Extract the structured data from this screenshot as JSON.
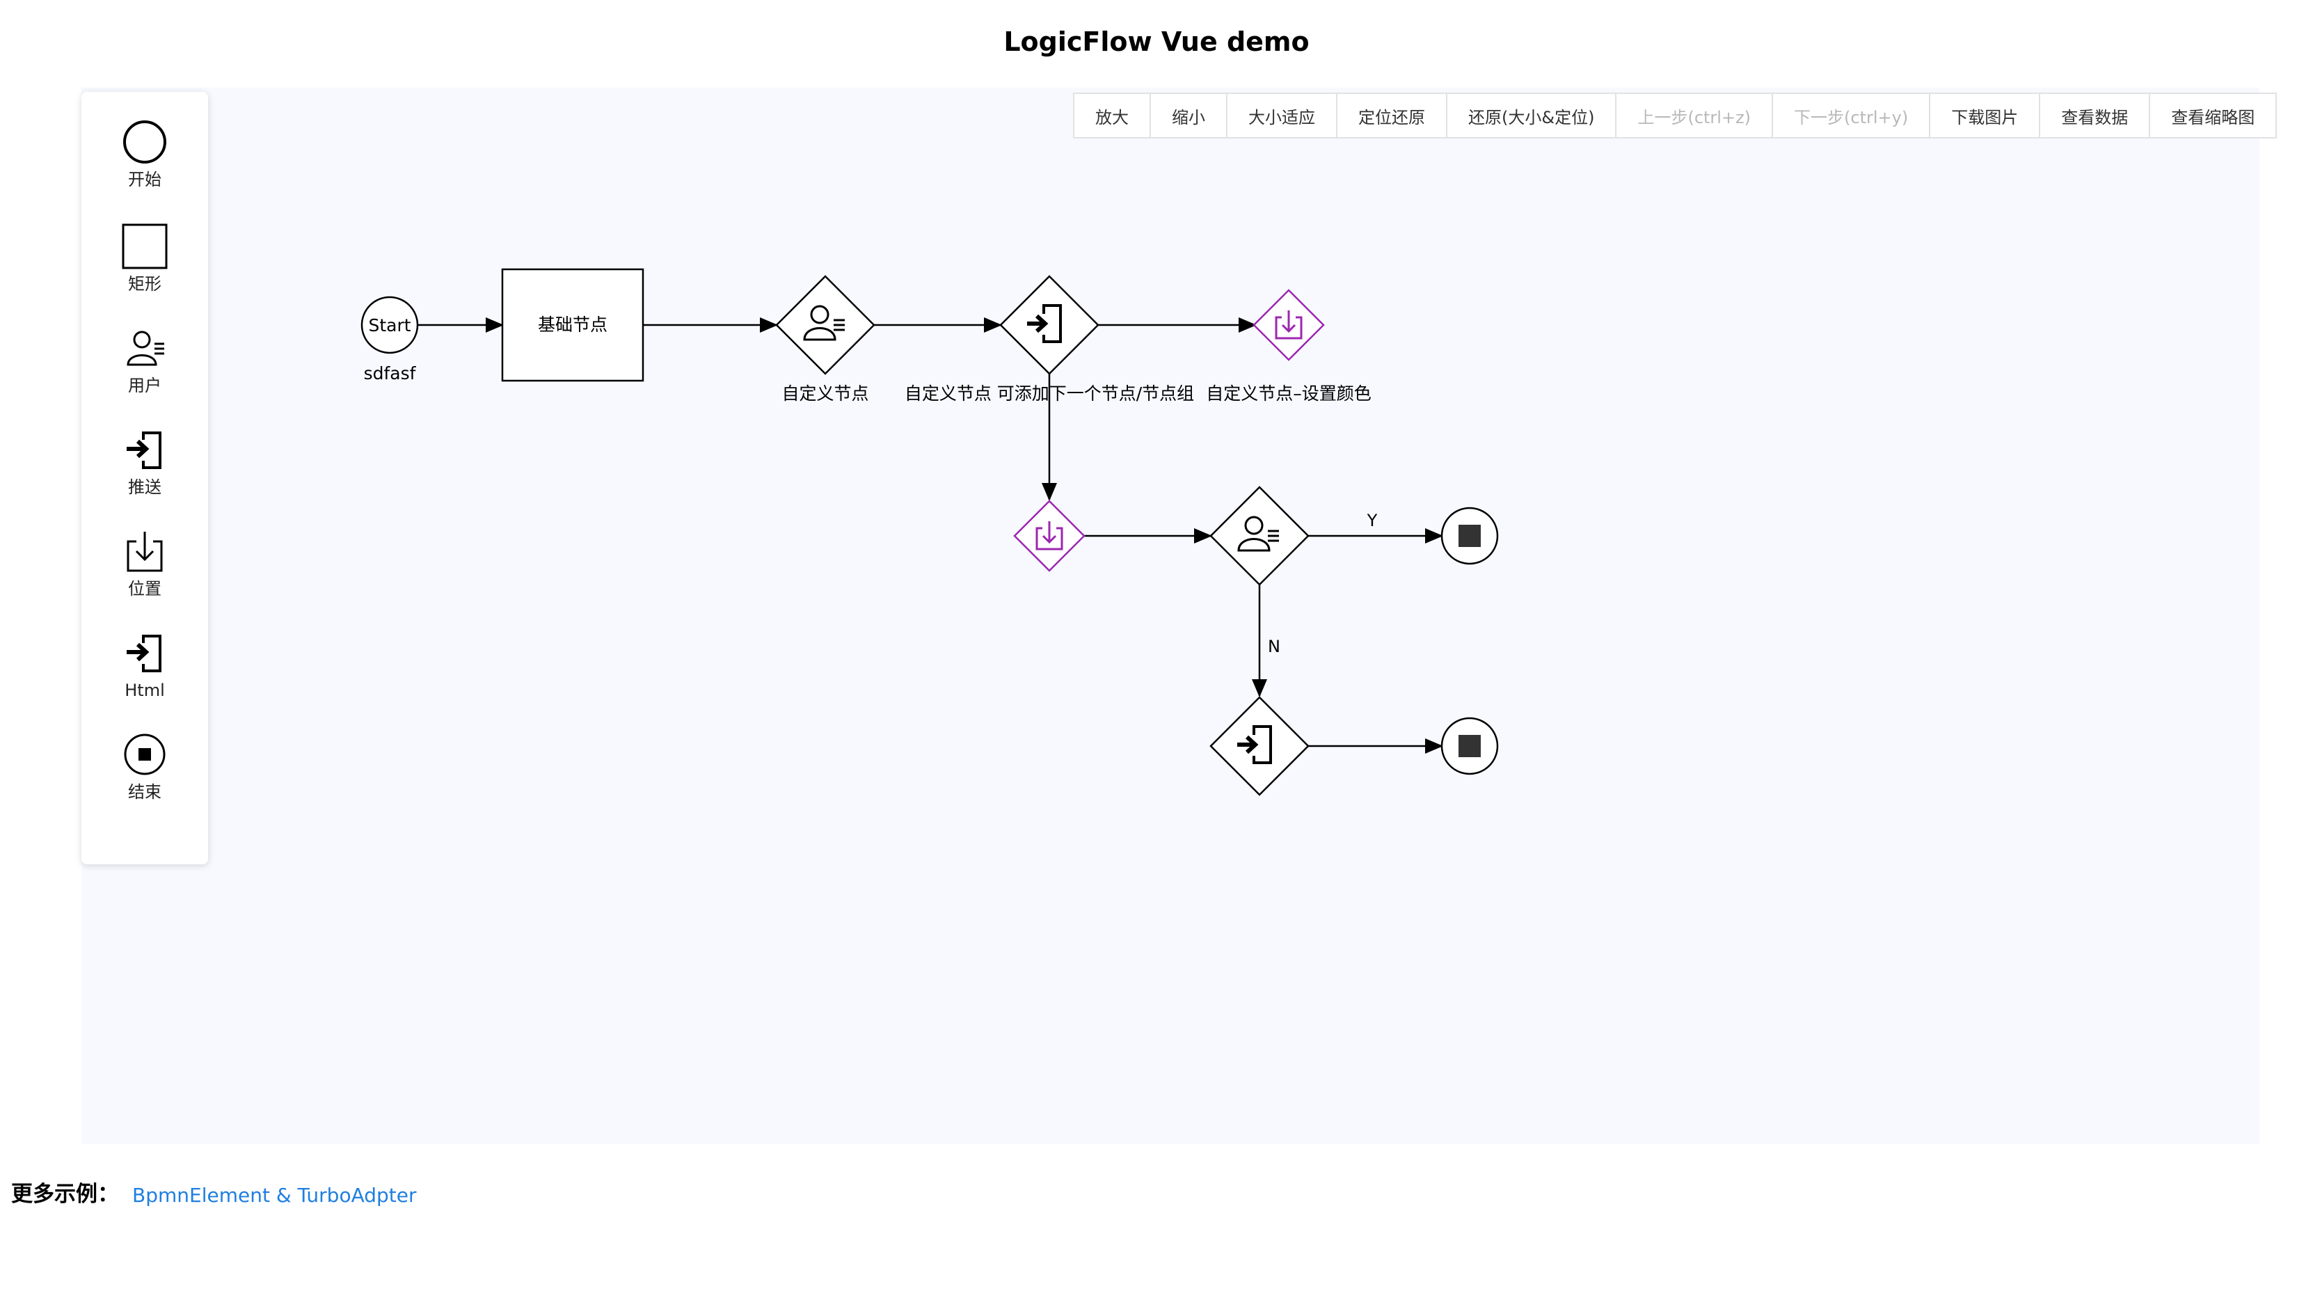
{
  "page": {
    "title": "LogicFlow Vue demo"
  },
  "palette": {
    "items": [
      {
        "label": "开始",
        "icon": "circle-icon"
      },
      {
        "label": "矩形",
        "icon": "rect-icon"
      },
      {
        "label": "用户",
        "icon": "user-icon"
      },
      {
        "label": "推送",
        "icon": "push-icon"
      },
      {
        "label": "位置",
        "icon": "download-icon"
      },
      {
        "label": "Html",
        "icon": "push-icon"
      },
      {
        "label": "结束",
        "icon": "end-icon"
      }
    ]
  },
  "toolbar": {
    "buttons": [
      {
        "label": "放大",
        "enabled": true
      },
      {
        "label": "缩小",
        "enabled": true
      },
      {
        "label": "大小适应",
        "enabled": true
      },
      {
        "label": "定位还原",
        "enabled": true
      },
      {
        "label": "还原(大小&定位)",
        "enabled": true
      },
      {
        "label": "上一步(ctrl+z)",
        "enabled": false
      },
      {
        "label": "下一步(ctrl+y)",
        "enabled": false
      },
      {
        "label": "下载图片",
        "enabled": true
      },
      {
        "label": "查看数据",
        "enabled": true
      },
      {
        "label": "查看缩略图",
        "enabled": true
      }
    ]
  },
  "diagram": {
    "start": {
      "text": "Start",
      "label": "sdfasf"
    },
    "rect": {
      "text": "基础节点"
    },
    "user1": {
      "label": "自定义节点"
    },
    "push1": {
      "label": "自定义节点 可添加下一个节点/节点组"
    },
    "download1": {
      "label": "自定义节点–设置颜色"
    },
    "edge_y": {
      "label": "Y"
    },
    "edge_n": {
      "label": "N"
    },
    "colors": {
      "accent": "#9c27b0",
      "stroke": "#000000",
      "end_fill": "#333333"
    }
  },
  "footer": {
    "label": "更多示例：",
    "link": "BpmnElement & TurboAdpter",
    "link_color": "#1f7fe0"
  }
}
